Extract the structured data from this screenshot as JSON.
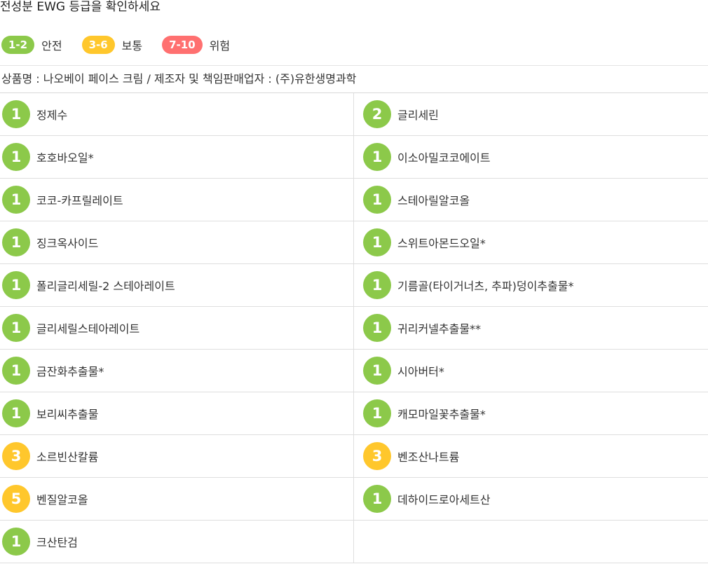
{
  "title": "전성분 EWG 등급을 확인하세요",
  "colors": {
    "safe": "#8cc94a",
    "moderate": "#ffc72c",
    "danger": "#ff7070"
  },
  "legend": [
    {
      "range": "1-2",
      "label": "안전",
      "level": "safe"
    },
    {
      "range": "3-6",
      "label": "보통",
      "level": "moderate"
    },
    {
      "range": "7-10",
      "label": "위험",
      "level": "danger"
    }
  ],
  "product_info": "상품명 : 나오베이 페이스 크림 / 제조자 및 책임판매업자 : (주)유한생명과학",
  "ingredients": [
    {
      "grade": "1",
      "name": "정제수"
    },
    {
      "grade": "2",
      "name": "글리세린"
    },
    {
      "grade": "1",
      "name": "호호바오일*"
    },
    {
      "grade": "1",
      "name": "이소아밀코코에이트"
    },
    {
      "grade": "1",
      "name": "코코-카프릴레이트"
    },
    {
      "grade": "1",
      "name": "스테아릴알코올"
    },
    {
      "grade": "1",
      "name": "징크옥사이드"
    },
    {
      "grade": "1",
      "name": "스위트아몬드오일*"
    },
    {
      "grade": "1",
      "name": "폴리글리세릴-2 스테아레이트"
    },
    {
      "grade": "1",
      "name": "기름골(타이거너츠, 추파)덩이추출물*"
    },
    {
      "grade": "1",
      "name": "글리세릴스테아레이트"
    },
    {
      "grade": "1",
      "name": "귀리커넬추출물**"
    },
    {
      "grade": "1",
      "name": "금잔화추출물*"
    },
    {
      "grade": "1",
      "name": "시아버터*"
    },
    {
      "grade": "1",
      "name": "보리씨추출물"
    },
    {
      "grade": "1",
      "name": "캐모마일꽃추출물*"
    },
    {
      "grade": "3",
      "name": "소르빈산칼륨"
    },
    {
      "grade": "3",
      "name": "벤조산나트륨"
    },
    {
      "grade": "5",
      "name": "벤질알코올"
    },
    {
      "grade": "1",
      "name": "데하이드로아세트산"
    },
    {
      "grade": "1",
      "name": "크산탄검"
    }
  ]
}
